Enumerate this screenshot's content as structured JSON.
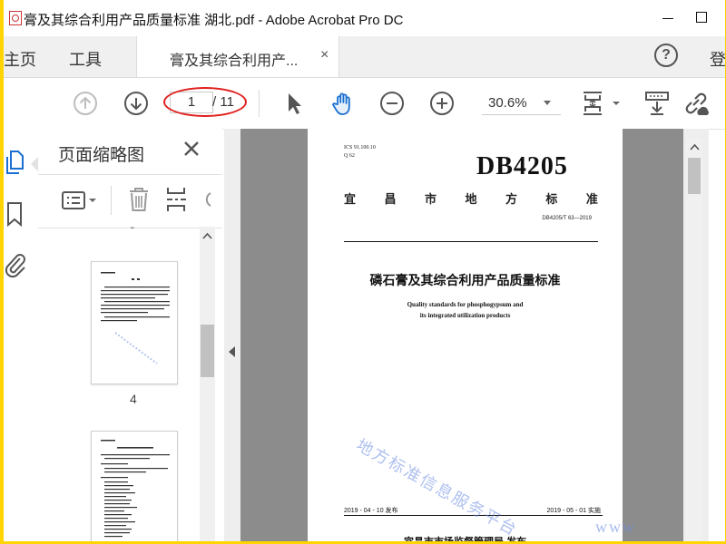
{
  "window": {
    "title": "膏及其综合利用产品质量标准 湖北.pdf - Adobe Acrobat Pro DC",
    "minimize_icon": "minimize-icon",
    "maximize_icon": "maximize-icon"
  },
  "tabs": {
    "home": "主页",
    "tools": "工具",
    "document": "膏及其综合利用产...",
    "close_glyph": "×",
    "help_glyph": "?",
    "signin": "登"
  },
  "toolbar": {
    "page_current": "1",
    "page_total": "/ 11",
    "zoom": "30.6%"
  },
  "thumbnails": {
    "title": "页面缩略图",
    "pages": [
      {
        "label": "4"
      },
      {
        "label": ""
      }
    ]
  },
  "document": {
    "ics_code": "ICS 91.100.10",
    "ccs_code": "Q 62",
    "db_code": "DB4205",
    "std_category_chars": [
      "宜",
      "昌",
      "市",
      "地",
      "方",
      "标",
      "准"
    ],
    "std_number": "DB4205/T 63—2019",
    "title_cn": "磷石膏及其综合利用产品质量标准",
    "title_en_line1": "Quality standards for phosphogypsum and",
    "title_en_line2": "its integrated utilization products",
    "issue_date": "2019 - 04 - 10 发布",
    "implement_date": "2019 - 05 - 01 实施",
    "publisher": "宜昌市市场监督管理局 发布",
    "watermark": "地方标准信息服务平台",
    "corner_watermark": "www"
  },
  "colors": {
    "highlight_frame": "#ffd400",
    "annotation_oval": "#e0201e",
    "doc_background": "#8c8c8c",
    "active_rail_icon": "#1a6fd1",
    "watermark": "#6e8ce1"
  }
}
